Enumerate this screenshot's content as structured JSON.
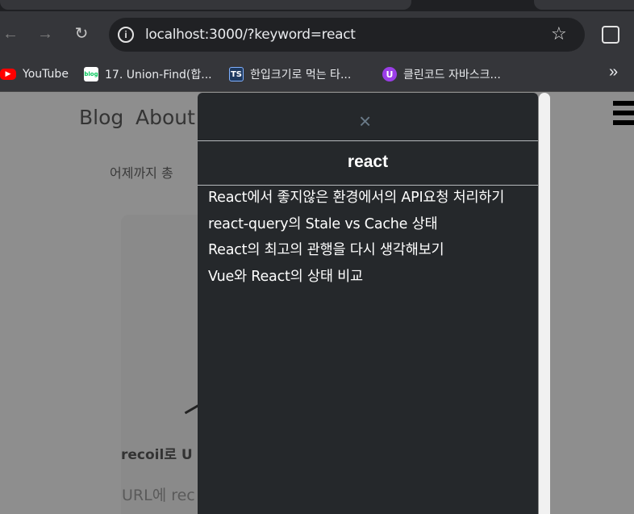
{
  "browser": {
    "back_icon": "←",
    "forward_icon": "→",
    "reload_icon": "↻",
    "url": "localhost:3000/?keyword=react",
    "info_icon": "i",
    "star_icon": "☆"
  },
  "bookmarks": {
    "items": [
      {
        "label": "YouTube",
        "icon": "youtube-icon",
        "glyph": "▶"
      },
      {
        "label": "17. Union-Find(합...",
        "icon": "blog-icon",
        "glyph": "blog"
      },
      {
        "label": "한입크기로 먹는 타...",
        "icon": "ts-icon",
        "glyph": "TS"
      },
      {
        "label": "클린코드 자바스크...",
        "icon": "u-icon",
        "glyph": "U"
      }
    ],
    "more_icon": "»"
  },
  "page": {
    "nav_blog": "Blog",
    "nav_about": "About",
    "visitors_text": "어제까지 총",
    "post_title": "recoil로 U",
    "post_desc": "URL에 rec"
  },
  "search_modal": {
    "close_icon": "×",
    "keyword": "react",
    "results": [
      "React에서 좋지않은 환경에서의 API요청 처리하기",
      "react-query의 Stale vs Cache 상태",
      "React의 최고의 관행을 다시 생각해보기",
      "Vue와 React의 상태 비교"
    ]
  }
}
